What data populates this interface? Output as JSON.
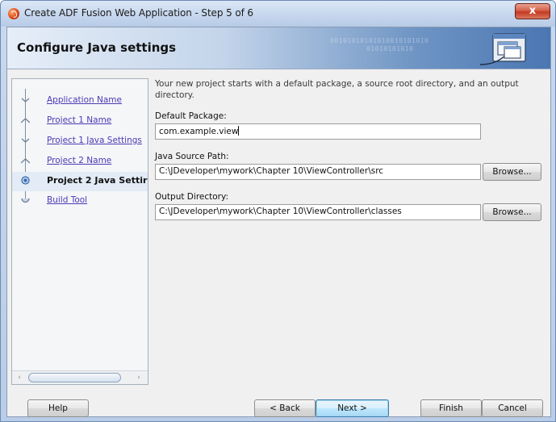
{
  "window": {
    "title": "Create ADF Fusion Web Application - Step 5 of 6",
    "close_label": "x"
  },
  "header": {
    "title": "Configure Java settings",
    "binary_line1": "00101010101010010101010",
    "binary_line2": "01010101010"
  },
  "nav": {
    "items": [
      {
        "label": "Application Name",
        "state": "done",
        "icon": "step-done-marker"
      },
      {
        "label": "Project 1 Name",
        "state": "done",
        "icon": "step-done-marker"
      },
      {
        "label": "Project 1 Java Settings",
        "state": "done",
        "icon": "step-done-marker"
      },
      {
        "label": "Project 2 Name",
        "state": "done",
        "icon": "step-done-marker"
      },
      {
        "label": "Project 2 Java Settir",
        "state": "active",
        "icon": "step-current-marker"
      },
      {
        "label": "Build Tool",
        "state": "pending",
        "icon": "step-end-marker"
      }
    ],
    "scroll_left": "‹",
    "scroll_right": "›"
  },
  "main": {
    "intro": "Your new project starts with a default package, a source root directory, and an output directory.",
    "default_package": {
      "label": "Default Package:",
      "value": "com.example.view"
    },
    "java_source_path": {
      "label": "Java Source Path:",
      "value": "C:\\JDeveloper\\mywork\\Chapter 10\\ViewController\\src",
      "browse": "Browse..."
    },
    "output_directory": {
      "label": "Output Directory:",
      "value": "C:\\JDeveloper\\mywork\\Chapter 10\\ViewController\\classes",
      "browse": "Browse..."
    }
  },
  "buttons": {
    "help": "Help",
    "back": "< Back",
    "next": "Next >",
    "finish": "Finish",
    "cancel": "Cancel"
  },
  "colors": {
    "link": "#4b3ab4",
    "header_gradient_end": "#4a76b2",
    "close_button": "#c43a22"
  }
}
